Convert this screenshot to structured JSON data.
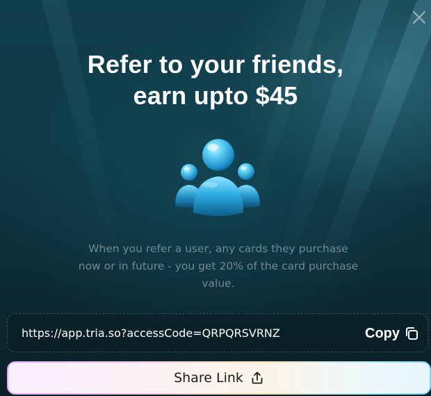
{
  "modal": {
    "title_line1": "Refer to your friends,",
    "title_line2": "earn upto $45",
    "description": "When you refer a user, any cards they purchase now or in future - you get 20% of the card purchase value."
  },
  "link": {
    "url": "https://app.tria.so?accessCode=QRPQRSVRNZ",
    "copy_label": "Copy"
  },
  "share": {
    "label": "Share Link"
  },
  "icons": {
    "close": "close-icon",
    "hero": "users-group-icon",
    "copy": "copy-icon",
    "share": "share-icon"
  }
}
